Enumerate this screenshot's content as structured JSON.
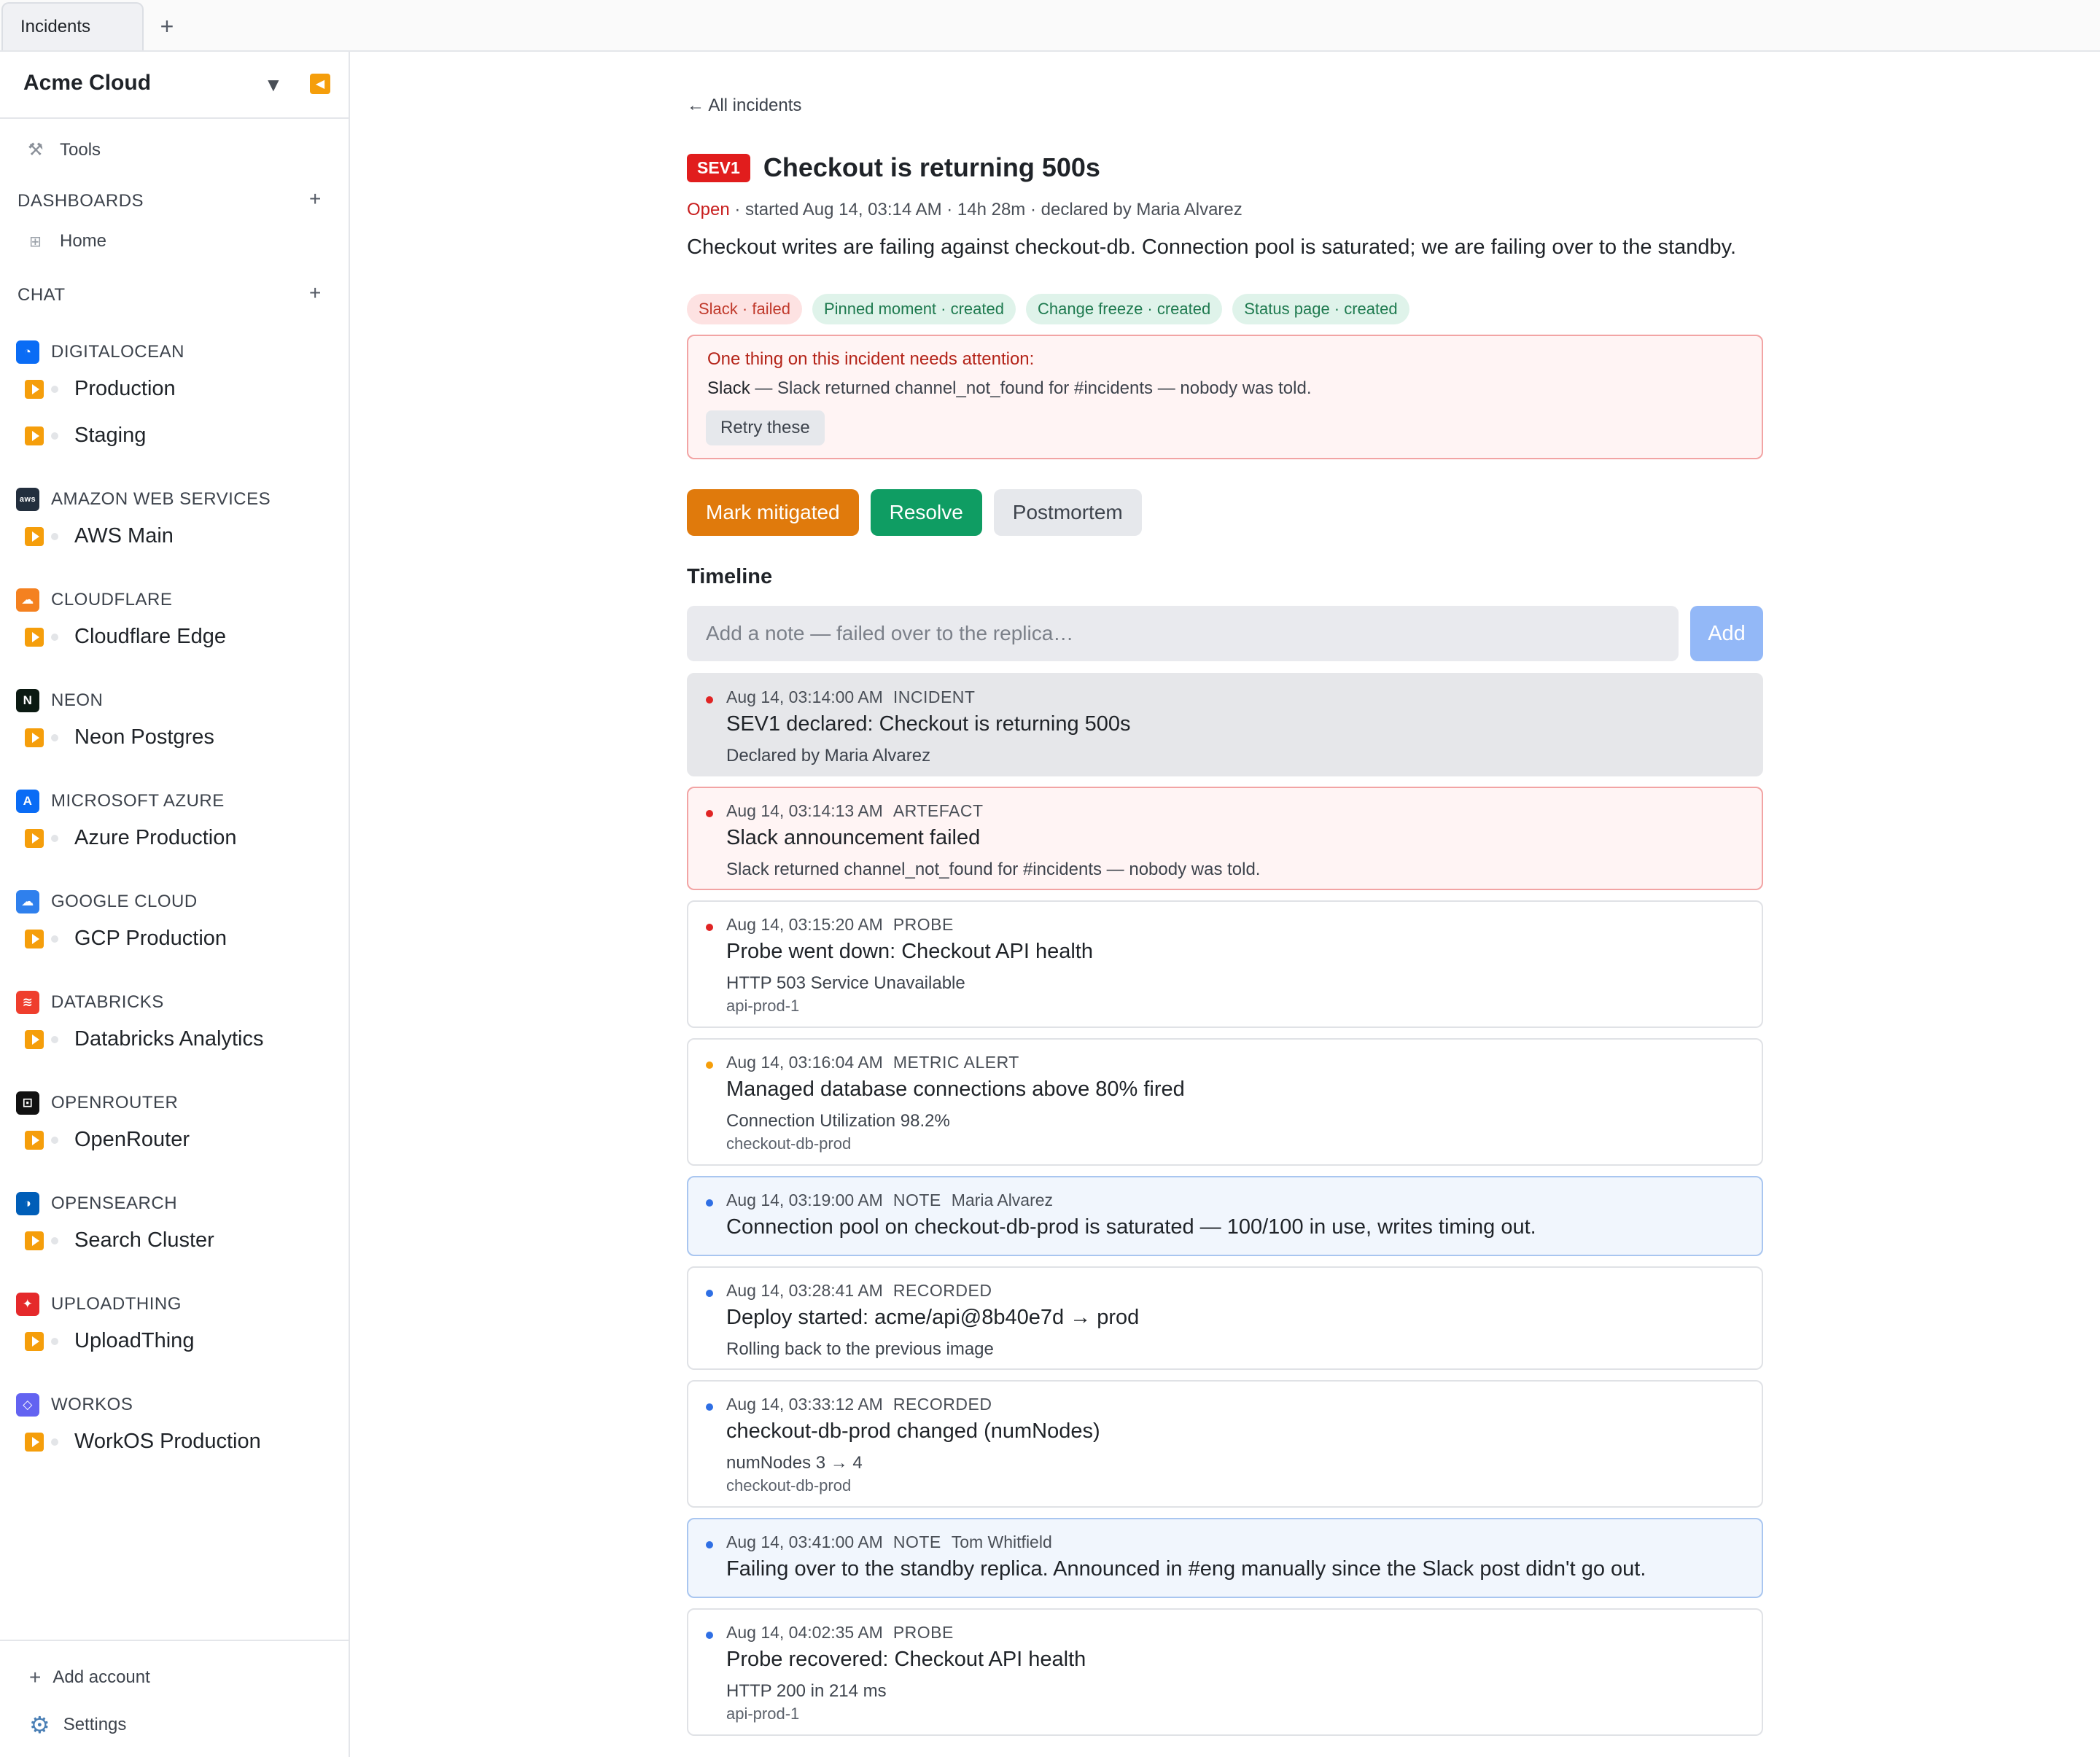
{
  "tabs": [
    {
      "label": "Incidents"
    }
  ],
  "sidebar": {
    "org_name": "Acme Cloud",
    "tools_label": "Tools",
    "dashboards_label": "DASHBOARDS",
    "home_label": "Home",
    "chat_label": "CHAT",
    "providers": [
      {
        "name": "DIGITALOCEAN",
        "icon": "digitalocean-icon",
        "color": "#0a6cf5",
        "glyph": "◔",
        "items": [
          "Production",
          "Staging"
        ]
      },
      {
        "name": "AMAZON WEB SERVICES",
        "icon": "aws-icon",
        "color": "#232f3e",
        "glyph": "aws",
        "items": [
          "AWS Main"
        ]
      },
      {
        "name": "CLOUDFLARE",
        "icon": "cloudflare-icon",
        "color": "#f48120",
        "glyph": "☁",
        "items": [
          "Cloudflare Edge"
        ]
      },
      {
        "name": "NEON",
        "icon": "neon-icon",
        "color": "#0b1a12",
        "glyph": "N",
        "items": [
          "Neon Postgres"
        ]
      },
      {
        "name": "MICROSOFT AZURE",
        "icon": "azure-icon",
        "color": "#0a6cf5",
        "glyph": "A",
        "items": [
          "Azure Production"
        ]
      },
      {
        "name": "GOOGLE CLOUD",
        "icon": "google-cloud-icon",
        "color": "#2f80ed",
        "glyph": "☁",
        "items": [
          "GCP Production"
        ]
      },
      {
        "name": "DATABRICKS",
        "icon": "databricks-icon",
        "color": "#ef3e2d",
        "glyph": "≋",
        "items": [
          "Databricks Analytics"
        ]
      },
      {
        "name": "OPENROUTER",
        "icon": "openrouter-icon",
        "color": "#111111",
        "glyph": "⊡",
        "items": [
          "OpenRouter"
        ]
      },
      {
        "name": "OPENSEARCH",
        "icon": "opensearch-icon",
        "color": "#005eb8",
        "glyph": "◑",
        "items": [
          "Search Cluster"
        ]
      },
      {
        "name": "UPLOADTHING",
        "icon": "uploadthing-icon",
        "color": "#e5292b",
        "glyph": "✦",
        "items": [
          "UploadThing"
        ]
      },
      {
        "name": "WORKOS",
        "icon": "workos-icon",
        "color": "#6363f1",
        "glyph": "◇",
        "items": [
          "WorkOS Production"
        ]
      }
    ],
    "add_account_label": "Add account",
    "settings_label": "Settings"
  },
  "incident": {
    "back_link": "← All incidents",
    "severity": "SEV1",
    "title": "Checkout is returning 500s",
    "status": "Open",
    "meta_rest": " · started Aug 14, 03:14 AM · 14h 28m · declared by Maria Alvarez",
    "summary": "Checkout writes are failing against checkout-db. Connection pool is saturated; we are failing over to the standby.",
    "chips": [
      {
        "label": "Slack · failed",
        "state": "failed"
      },
      {
        "label": "Pinned moment · created",
        "state": "created"
      },
      {
        "label": "Change freeze · created",
        "state": "created"
      },
      {
        "label": "Status page · created",
        "state": "created"
      }
    ],
    "attention": {
      "title": "One thing on this incident needs attention:",
      "service": "Slack",
      "message": " — Slack returned channel_not_found for #incidents — nobody was told.",
      "retry_label": "Retry these"
    },
    "actions": {
      "mitigate": "Mark mitigated",
      "resolve": "Resolve",
      "postmortem": "Postmortem"
    },
    "timeline": {
      "heading": "Timeline",
      "input_placeholder": "Add a note — failed over to the replica…",
      "add_label": "Add",
      "entries": [
        {
          "time": "Aug 14, 03:14:00 AM",
          "kind": "INCIDENT",
          "author": "",
          "title": "SEV1 declared: Checkout is returning 500s",
          "detail": "Declared by Maria Alvarez",
          "sub": "",
          "style": "incident",
          "dot": "red"
        },
        {
          "time": "Aug 14, 03:14:13 AM",
          "kind": "ARTEFACT",
          "author": "",
          "title": "Slack announcement failed",
          "detail": "Slack returned channel_not_found for #incidents — nobody was told.",
          "sub": "",
          "style": "failed",
          "dot": "red"
        },
        {
          "time": "Aug 14, 03:15:20 AM",
          "kind": "PROBE",
          "author": "",
          "title": "Probe went down: Checkout API health",
          "detail": "HTTP 503 Service Unavailable",
          "sub": "api-prod-1",
          "style": "plain",
          "dot": "red"
        },
        {
          "time": "Aug 14, 03:16:04 AM",
          "kind": "METRIC ALERT",
          "author": "",
          "title": "Managed database connections above 80% fired",
          "detail": "Connection Utilization 98.2%",
          "sub": "checkout-db-prod",
          "style": "plain",
          "dot": "orange"
        },
        {
          "time": "Aug 14, 03:19:00 AM",
          "kind": "NOTE",
          "author": "Maria Alvarez",
          "title": "Connection pool on checkout-db-prod is saturated — 100/100 in use, writes timing out.",
          "detail": "",
          "sub": "",
          "style": "note",
          "dot": "blue"
        },
        {
          "time": "Aug 14, 03:28:41 AM",
          "kind": "RECORDED",
          "author": "",
          "title": "Deploy started: acme/api@8b40e7d → prod",
          "detail": "Rolling back to the previous image",
          "sub": "",
          "style": "plain",
          "dot": "blue"
        },
        {
          "time": "Aug 14, 03:33:12 AM",
          "kind": "RECORDED",
          "author": "",
          "title": "checkout-db-prod changed (numNodes)",
          "detail": "numNodes 3 → 4",
          "sub": "checkout-db-prod",
          "style": "plain",
          "dot": "blue"
        },
        {
          "time": "Aug 14, 03:41:00 AM",
          "kind": "NOTE",
          "author": "Tom Whitfield",
          "title": "Failing over to the standby replica. Announced in #eng manually since the Slack post didn't go out.",
          "detail": "",
          "sub": "",
          "style": "note",
          "dot": "blue"
        },
        {
          "time": "Aug 14, 04:02:35 AM",
          "kind": "PROBE",
          "author": "",
          "title": "Probe recovered: Checkout API health",
          "detail": "HTTP 200 in 214 ms",
          "sub": "api-prod-1",
          "style": "plain",
          "dot": "blue"
        }
      ]
    }
  }
}
